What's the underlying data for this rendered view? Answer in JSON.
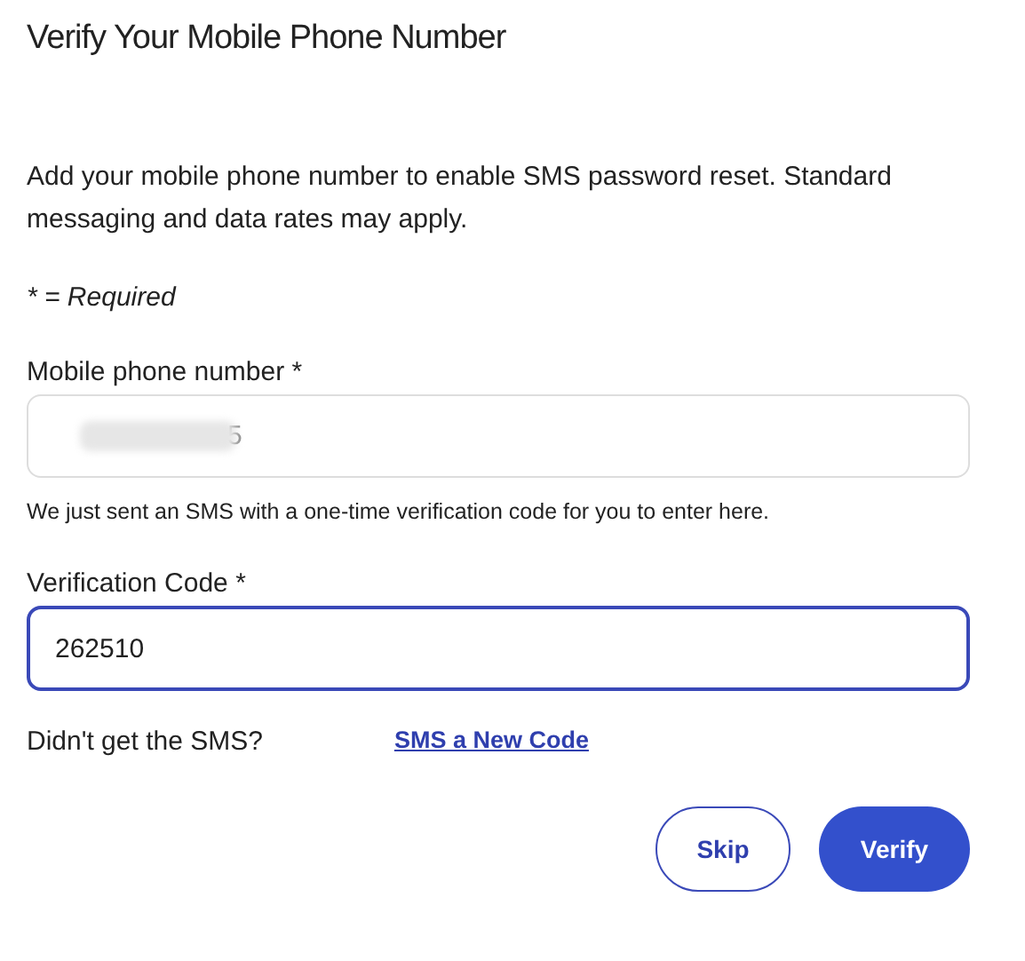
{
  "title": "Verify Your Mobile Phone Number",
  "intro": "Add your mobile phone number to enable SMS password reset. Standard messaging and data rates may apply.",
  "required_note": "* = Required",
  "fields": [
    {
      "label": "Mobile phone number *",
      "value": "5",
      "redacted": true,
      "focused": false,
      "help": "We just sent an SMS with a one-time verification code for you to enter here."
    },
    {
      "label": "Verification Code *",
      "value": "262510",
      "redacted": false,
      "focused": true
    }
  ],
  "resend": {
    "prompt": "Didn't get the SMS?",
    "link": "SMS a New Code"
  },
  "buttons": [
    {
      "label": "Skip",
      "kind": "secondary"
    },
    {
      "label": "Verify",
      "kind": "primary"
    }
  ]
}
